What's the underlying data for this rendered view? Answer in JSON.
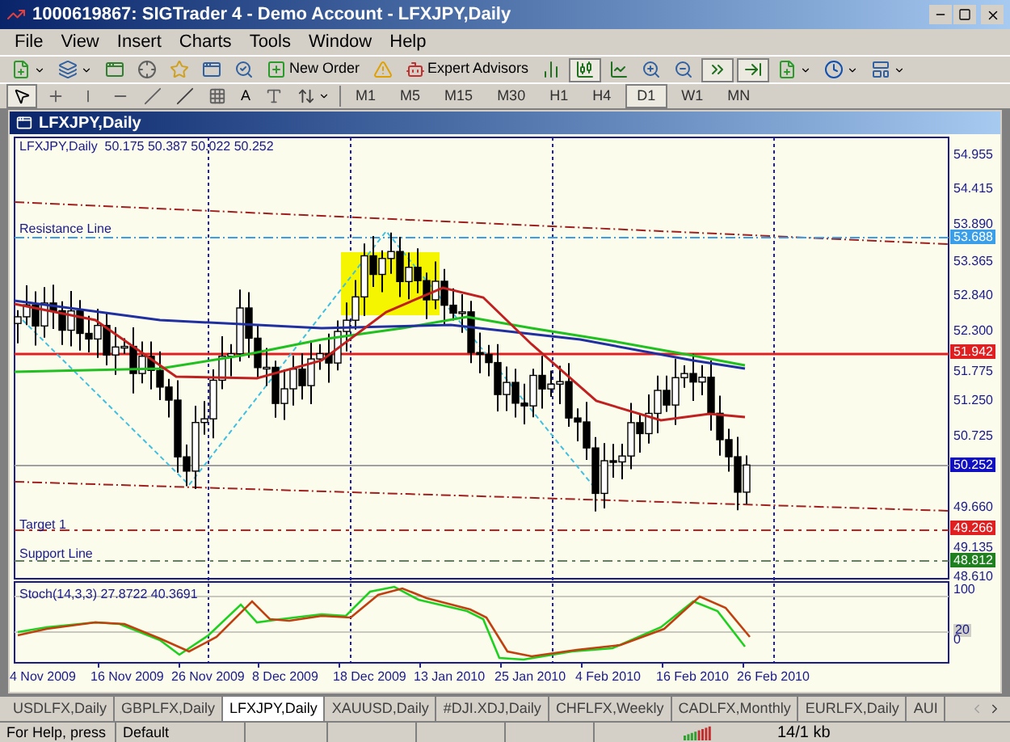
{
  "window": {
    "title": "1000619867: SIGTrader 4 - Demo Account - LFXJPY,Daily"
  },
  "menu": [
    {
      "label": "File"
    },
    {
      "label": "View"
    },
    {
      "label": "Insert"
    },
    {
      "label": "Charts"
    },
    {
      "label": "Tools"
    },
    {
      "label": "Window"
    },
    {
      "label": "Help"
    }
  ],
  "toolbar": {
    "new_order": "New Order",
    "expert_advisors": "Expert Advisors",
    "text_tool": "A"
  },
  "timeframes": [
    {
      "label": "M1",
      "selected": false
    },
    {
      "label": "M5",
      "selected": false
    },
    {
      "label": "M15",
      "selected": false
    },
    {
      "label": "M30",
      "selected": false
    },
    {
      "label": "H1",
      "selected": false
    },
    {
      "label": "H4",
      "selected": false
    },
    {
      "label": "D1",
      "selected": true
    },
    {
      "label": "W1",
      "selected": false
    },
    {
      "label": "MN",
      "selected": false
    }
  ],
  "chart": {
    "title": "LFXJPY,Daily",
    "header": "LFXJPY,Daily  50.175 50.387 50.022 50.252",
    "price_labels": [
      "54.955",
      "54.415",
      "53.890",
      "53.365",
      "52.840",
      "52.300",
      "51.775",
      "51.250",
      "50.725",
      "49.660",
      "49.135",
      "48.610"
    ],
    "badges": [
      {
        "value": "53.688",
        "color": "#3a9ee8"
      },
      {
        "value": "51.942",
        "color": "#e02020"
      },
      {
        "value": "50.252",
        "color": "#1010c0"
      },
      {
        "value": "49.266",
        "color": "#e02020"
      },
      {
        "value": "48.812",
        "color": "#208020"
      }
    ],
    "line_labels": [
      "Resistance Line",
      "Target 1",
      "Support Line"
    ],
    "indicator": {
      "label": "Stoch(14,3,3) 27.8722 40.3691",
      "scale": [
        "100",
        "20",
        "0"
      ]
    },
    "dates": [
      "4 Nov 2009",
      "16 Nov 2009",
      "26 Nov 2009",
      "8 Dec 2009",
      "18 Dec 2009",
      "13 Jan 2010",
      "25 Jan 2010",
      "4 Feb 2010",
      "16 Feb 2010",
      "26 Feb 2010"
    ]
  },
  "tabs": [
    {
      "label": "USDLFX,Daily",
      "selected": false
    },
    {
      "label": "GBPLFX,Daily",
      "selected": false
    },
    {
      "label": "LFXJPY,Daily",
      "selected": true
    },
    {
      "label": "XAUUSD,Daily",
      "selected": false
    },
    {
      "label": "#DJI.XDJ,Daily",
      "selected": false
    },
    {
      "label": "CHFLFX,Weekly",
      "selected": false
    },
    {
      "label": "CADLFX,Monthly",
      "selected": false
    },
    {
      "label": "EURLFX,Daily",
      "selected": false
    },
    {
      "label": "AUI",
      "selected": false
    }
  ],
  "status_bar": {
    "help": "For Help, press",
    "profile": "Default",
    "traffic": "14/1 kb"
  }
}
